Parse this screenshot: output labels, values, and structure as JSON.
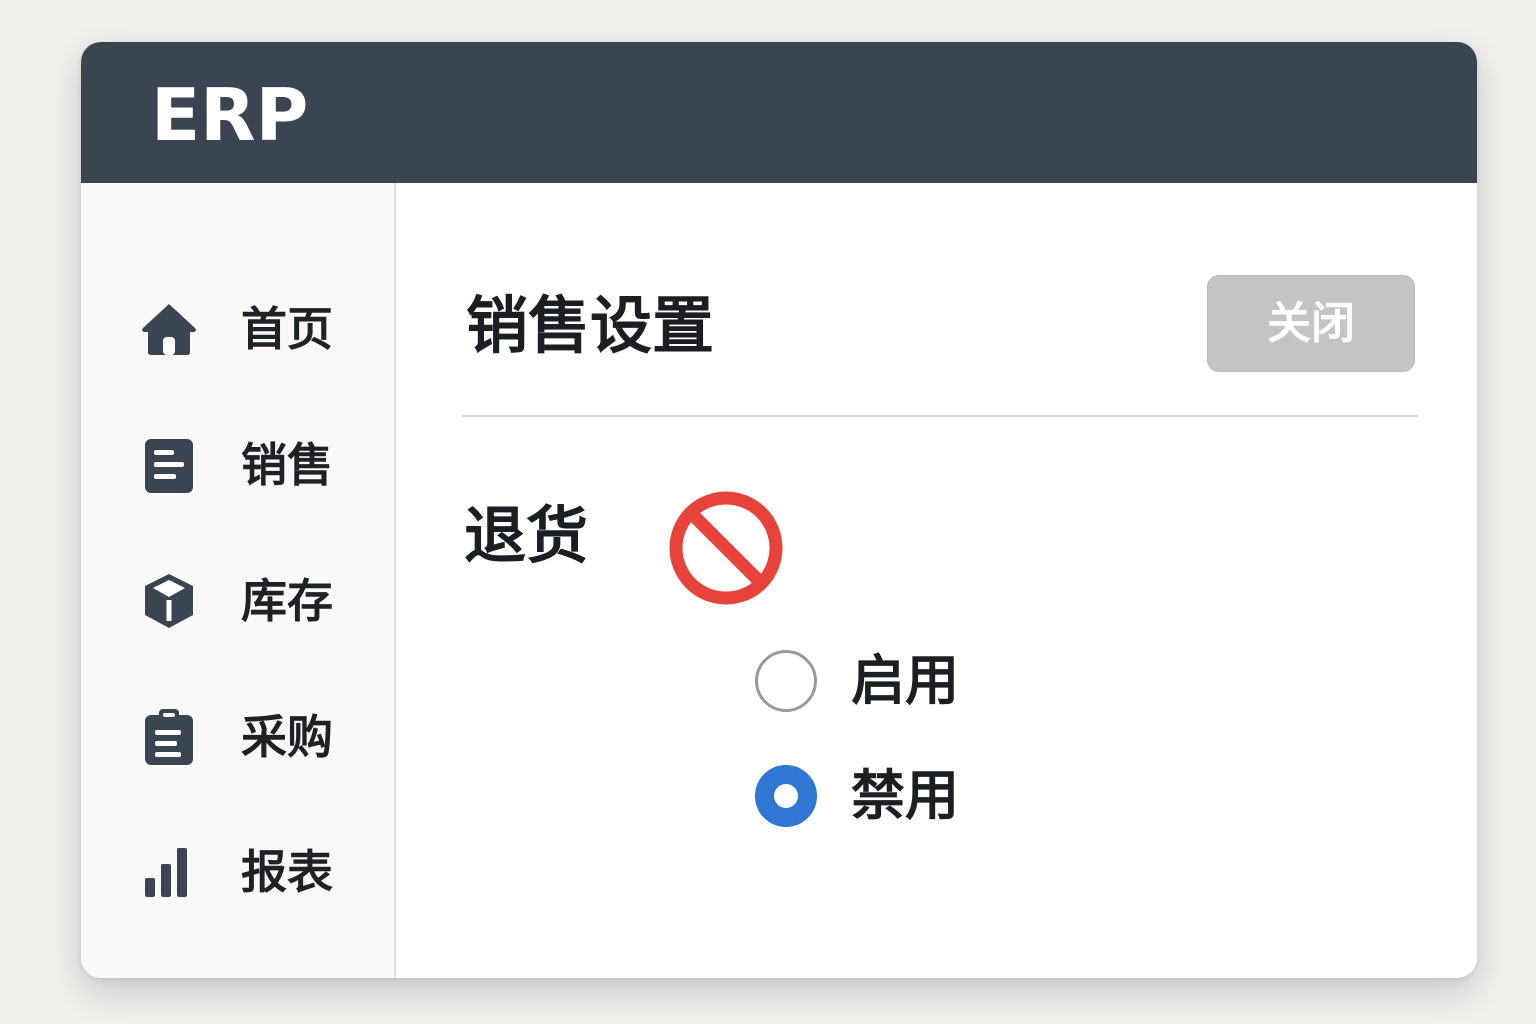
{
  "app": {
    "title": "ERP"
  },
  "sidebar": {
    "items": [
      {
        "label": "首页",
        "icon": "home-icon"
      },
      {
        "label": "销售",
        "icon": "document-icon"
      },
      {
        "label": "库存",
        "icon": "box-icon"
      },
      {
        "label": "采购",
        "icon": "clipboard-icon"
      },
      {
        "label": "报表",
        "icon": "bar-chart-icon"
      }
    ]
  },
  "main": {
    "title": "销售设置",
    "close_label": "关闭",
    "setting": {
      "label": "退货",
      "status_icon": "prohibited-icon",
      "options": [
        {
          "label": "启用",
          "selected": false
        },
        {
          "label": "禁用",
          "selected": true
        }
      ]
    }
  },
  "colors": {
    "header_bg": "#3a4551",
    "sidebar_bg": "#f9f9f7",
    "icon_color": "#3a4551",
    "close_button_bg": "#c4c4c4",
    "prohibited_red": "#e8433a",
    "radio_selected": "#2f77d3"
  }
}
